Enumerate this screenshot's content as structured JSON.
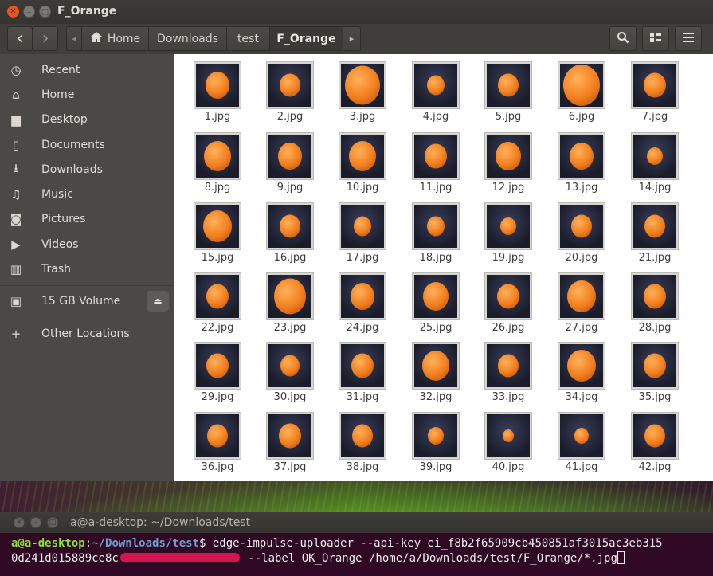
{
  "window": {
    "title": "F_Orange"
  },
  "toolbar": {
    "back_label": "‹",
    "forward_label": "›",
    "crumbs": [
      "Home",
      "Downloads",
      "test",
      "F_Orange"
    ],
    "crumb_left_arrow": "◂",
    "crumb_right_arrow": "▸"
  },
  "sidebar": {
    "items": [
      {
        "label": "Recent",
        "icon": "clock-icon"
      },
      {
        "label": "Home",
        "icon": "home-icon"
      },
      {
        "label": "Desktop",
        "icon": "folder-icon"
      },
      {
        "label": "Documents",
        "icon": "document-icon"
      },
      {
        "label": "Downloads",
        "icon": "download-icon"
      },
      {
        "label": "Music",
        "icon": "music-icon"
      },
      {
        "label": "Pictures",
        "icon": "camera-icon"
      },
      {
        "label": "Videos",
        "icon": "video-icon"
      },
      {
        "label": "Trash",
        "icon": "trash-icon"
      },
      {
        "label": "15 GB Volume",
        "icon": "drive-icon"
      },
      {
        "label": "Other Locations",
        "icon": "plus-icon"
      }
    ]
  },
  "files": [
    "1.jpg",
    "2.jpg",
    "3.jpg",
    "4.jpg",
    "5.jpg",
    "6.jpg",
    "7.jpg",
    "8.jpg",
    "9.jpg",
    "10.jpg",
    "11.jpg",
    "12.jpg",
    "13.jpg",
    "14.jpg",
    "15.jpg",
    "16.jpg",
    "17.jpg",
    "18.jpg",
    "19.jpg",
    "20.jpg",
    "21.jpg",
    "22.jpg",
    "23.jpg",
    "24.jpg",
    "25.jpg",
    "26.jpg",
    "27.jpg",
    "28.jpg",
    "29.jpg",
    "30.jpg",
    "31.jpg",
    "32.jpg",
    "33.jpg",
    "34.jpg",
    "35.jpg",
    "36.jpg",
    "37.jpg",
    "38.jpg",
    "39.jpg",
    "40.jpg",
    "41.jpg",
    "42.jpg"
  ],
  "terminal": {
    "title": "a@a-desktop: ~/Downloads/test",
    "prompt_user": "a@a-desktop",
    "prompt_sep": ":",
    "prompt_path": "~/Downloads/test",
    "prompt_end": "$",
    "line1_cmd": " edge-impulse-uploader --api-key ei_f8b2f65909cb450851af3015ac3eb315",
    "line2_start": "0d241d015889ce8c",
    "line2_end": " --label OK_Orange /home/a/Downloads/test/F_Orange/*.jpg"
  },
  "colors": {
    "accent": "#e95420",
    "terminal_bg": "#300a24",
    "sidebar_bg": "#4a4945"
  }
}
